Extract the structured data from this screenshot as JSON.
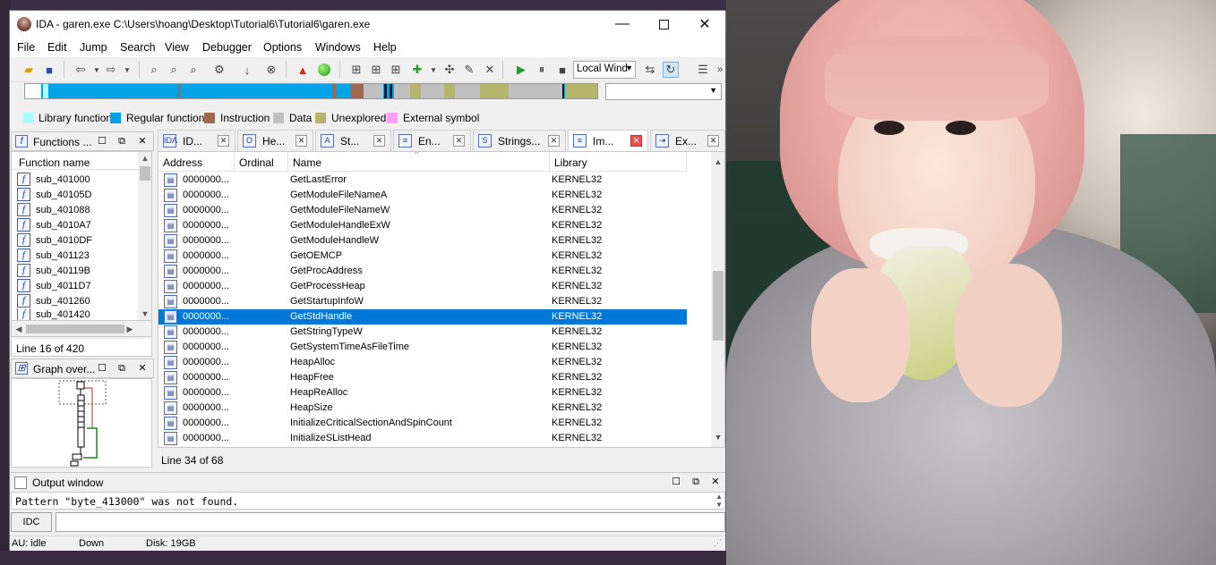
{
  "window": {
    "title": "IDA - garen.exe C:\\Users\\hoang\\Desktop\\Tutorial6\\Tutorial6\\garen.exe",
    "min_label": "—",
    "close_label": "✕"
  },
  "menu": [
    "File",
    "Edit",
    "Jump",
    "Search",
    "View",
    "Debugger",
    "Options",
    "Windows",
    "Help"
  ],
  "toolbar": {
    "debugger_select": "Local Wind"
  },
  "legend": [
    {
      "label": "Library function",
      "color": "#aaffff"
    },
    {
      "label": "Regular function",
      "color": "#00a2e8"
    },
    {
      "label": "Instruction",
      "color": "#a0684e"
    },
    {
      "label": "Data",
      "color": "#c0c0c0"
    },
    {
      "label": "Unexplored",
      "color": "#b5b56b"
    },
    {
      "label": "External symbol",
      "color": "#ff9eff"
    }
  ],
  "functions_panel": {
    "title": "Functions ...",
    "column": "Function name",
    "items": [
      "sub_401000",
      "sub_40105D",
      "sub_401088",
      "sub_4010A7",
      "sub_4010DF",
      "sub_401123",
      "sub_40119B",
      "sub_4011D7",
      "sub_401260",
      "sub_401420"
    ],
    "status": "Line 16 of 420"
  },
  "graph_panel": {
    "title": "Graph over..."
  },
  "tabs": [
    {
      "label": "ID...",
      "icon": "IDA",
      "active": false
    },
    {
      "label": "He...",
      "icon": "O",
      "active": false
    },
    {
      "label": "St...",
      "icon": "A",
      "active": false
    },
    {
      "label": "En...",
      "icon": "≡",
      "active": false
    },
    {
      "label": "Strings...",
      "icon": "S",
      "active": false
    },
    {
      "label": "Im...",
      "icon": "≡",
      "active": true
    },
    {
      "label": "Ex...",
      "icon": "⇥",
      "active": false
    }
  ],
  "imports": {
    "columns": [
      "Address",
      "Ordinal",
      "Name",
      "Library"
    ],
    "rows": [
      {
        "address": "0000000...",
        "name": "GetLastError",
        "library": "KERNEL32"
      },
      {
        "address": "0000000...",
        "name": "GetModuleFileNameA",
        "library": "KERNEL32"
      },
      {
        "address": "0000000...",
        "name": "GetModuleFileNameW",
        "library": "KERNEL32"
      },
      {
        "address": "0000000...",
        "name": "GetModuleHandleExW",
        "library": "KERNEL32"
      },
      {
        "address": "0000000...",
        "name": "GetModuleHandleW",
        "library": "KERNEL32"
      },
      {
        "address": "0000000...",
        "name": "GetOEMCP",
        "library": "KERNEL32"
      },
      {
        "address": "0000000...",
        "name": "GetProcAddress",
        "library": "KERNEL32"
      },
      {
        "address": "0000000...",
        "name": "GetProcessHeap",
        "library": "KERNEL32"
      },
      {
        "address": "0000000...",
        "name": "GetStartupInfoW",
        "library": "KERNEL32"
      },
      {
        "address": "0000000...",
        "name": "GetStdHandle",
        "library": "KERNEL32",
        "selected": true
      },
      {
        "address": "0000000...",
        "name": "GetStringTypeW",
        "library": "KERNEL32"
      },
      {
        "address": "0000000...",
        "name": "GetSystemTimeAsFileTime",
        "library": "KERNEL32"
      },
      {
        "address": "0000000...",
        "name": "HeapAlloc",
        "library": "KERNEL32"
      },
      {
        "address": "0000000...",
        "name": "HeapFree",
        "library": "KERNEL32"
      },
      {
        "address": "0000000...",
        "name": "HeapReAlloc",
        "library": "KERNEL32"
      },
      {
        "address": "0000000...",
        "name": "HeapSize",
        "library": "KERNEL32"
      },
      {
        "address": "0000000...",
        "name": "InitializeCriticalSectionAndSpinCount",
        "library": "KERNEL32"
      },
      {
        "address": "0000000...",
        "name": "InitializeSListHead",
        "library": "KERNEL32"
      }
    ],
    "status": "Line 34 of 68"
  },
  "output": {
    "title": "Output window",
    "text": "Pattern \"byte_413000\" was not found.",
    "idc_label": "IDC"
  },
  "status": {
    "au": "AU:  idle",
    "dir": "Down",
    "disk": "Disk: 19GB"
  }
}
